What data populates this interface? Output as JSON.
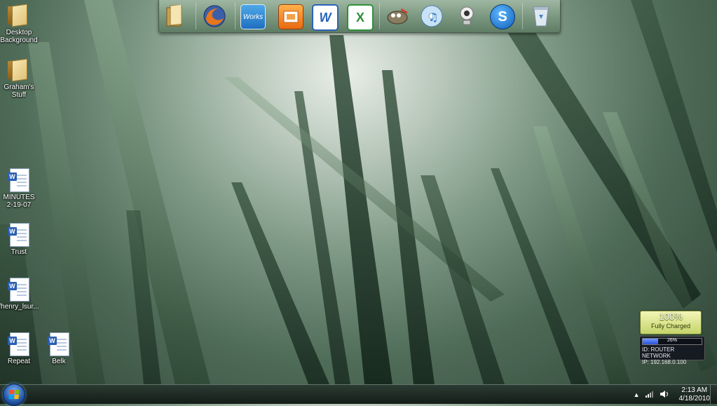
{
  "desktop": {
    "icons": [
      {
        "label": "Desktop\nBackground",
        "type": "folder"
      },
      {
        "label": "Graham's\nStuff",
        "type": "folder"
      },
      {
        "label": "MINUTES\n2-19-07",
        "type": "doc"
      },
      {
        "label": "Trust",
        "type": "doc"
      },
      {
        "label": "fhenry_lsur...",
        "type": "doc"
      },
      {
        "label": "Repeat",
        "type": "doc"
      },
      {
        "label": "Belk",
        "type": "doc"
      }
    ]
  },
  "dock": {
    "items": [
      {
        "icon": "folder-icon"
      },
      {
        "icon": "firefox-icon"
      },
      {
        "icon": "works-icon",
        "text": "Works"
      },
      {
        "icon": "presentation-icon"
      },
      {
        "icon": "word-icon",
        "text": "W"
      },
      {
        "icon": "excel-icon",
        "text": "X"
      },
      {
        "icon": "gimp-icon"
      },
      {
        "icon": "itunes-icon"
      },
      {
        "icon": "webcam-icon"
      },
      {
        "icon": "skype-icon",
        "text": "S"
      },
      {
        "icon": "recycle-bin-icon"
      }
    ]
  },
  "gadgets": {
    "battery": {
      "percent": "100%",
      "status": "Fully Charged"
    },
    "network": {
      "signal": "26%",
      "signal_level": 0.26,
      "id": "ID: ROUTER NETWORK",
      "ip": "IP: 192.168.0.100"
    }
  },
  "taskbar": {
    "tray_icons": [
      "show-hidden-icons-arrow",
      "network-signal-icon",
      "volume-icon"
    ],
    "time": "2:13 AM",
    "date": "4/18/2010"
  },
  "colors": {
    "taskbar": "#1a2620",
    "dock": "#7c9880",
    "battery": "#c4d46a"
  }
}
